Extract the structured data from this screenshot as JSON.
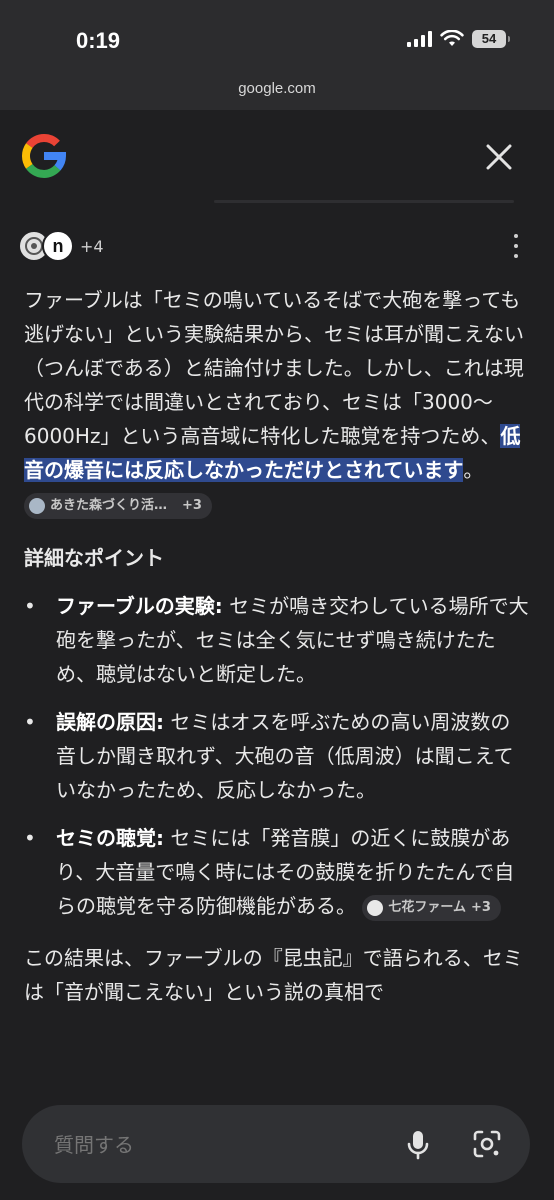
{
  "status_bar": {
    "time": "0:19",
    "battery": "54"
  },
  "url_bar": {
    "domain": "google.com"
  },
  "sources": {
    "more_count": "+4",
    "avatar_letter": "n"
  },
  "answer": {
    "para1_text": "ファーブルは「セミの鳴いているそばで大砲を撃っても逃げない」という実験結果から、セミは耳が聞こえない（つんぼである）と結論付けました。しかし、これは現代の科学では間違いとされており、セミは「3000〜6000Hz」という高音域に特化した聴覚を持つため、",
    "para1_highlight": "低音の爆音には反応しなかっただけとされています",
    "para1_end": "。",
    "citation1": {
      "label": "あきた森づくり活…",
      "more": "+3"
    },
    "heading": "詳細なポイント",
    "bullets": [
      {
        "title": "ファーブルの実験:",
        "text": " セミが鳴き交わしている場所で大砲を撃ったが、セミは全く気にせず鳴き続けたため、聴覚はないと断定した。"
      },
      {
        "title": "誤解の原因:",
        "text": " セミはオスを呼ぶための高い周波数の音しか聞き取れず、大砲の音（低周波）は聞こえていなかったため、反応しなかった。"
      },
      {
        "title": "セミの聴覚:",
        "text": " セミには「発音膜」の近くに鼓膜があり、大音量で鳴く時にはその鼓膜を折りたたんで自らの聴覚を守る防御機能がある。"
      }
    ],
    "citation2": {
      "label": "七花ファーム",
      "more": "+3"
    },
    "para2_text": "この結果は、ファーブルの『昆虫記』で語られる、セミは「音が聞こえない」という説の真相で"
  },
  "search": {
    "placeholder": "質問する"
  },
  "colors": {
    "background": "#1f1f21",
    "highlight": "#2f4a8f",
    "chip": "#323236",
    "searchbar": "#303134"
  }
}
